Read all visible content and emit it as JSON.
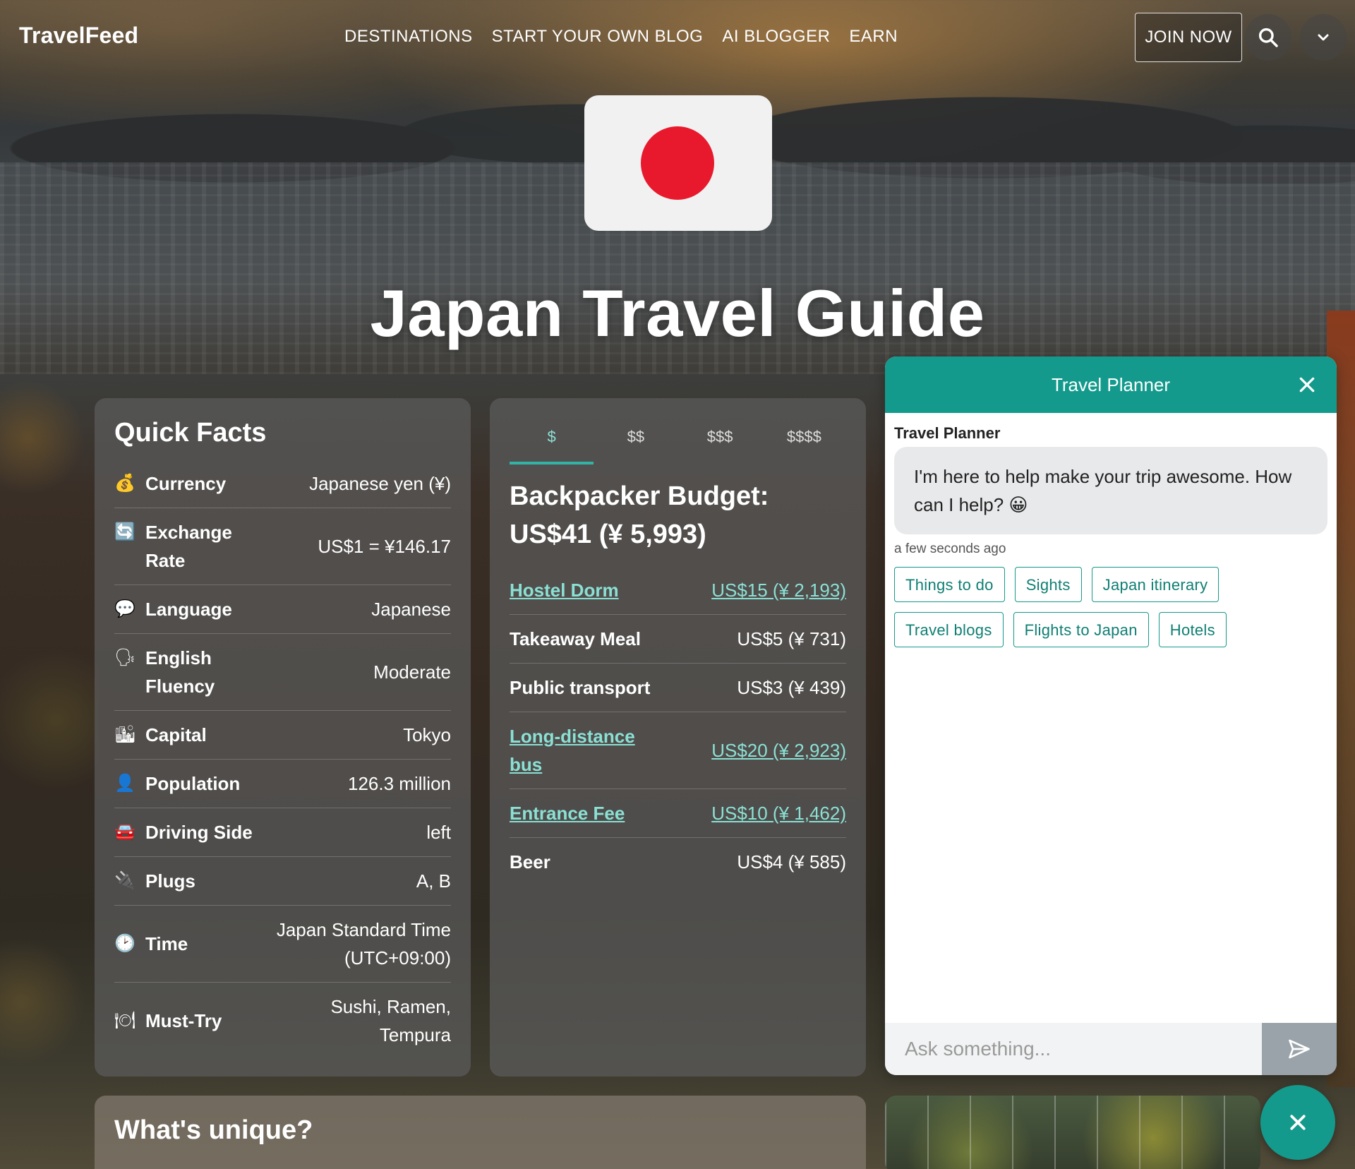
{
  "header": {
    "logo": "TravelFeed",
    "nav": [
      "DESTINATIONS",
      "START YOUR OWN BLOG",
      "AI BLOGGER",
      "EARN"
    ],
    "join_label": "JOIN NOW"
  },
  "hero": {
    "title": "Japan Travel Guide"
  },
  "quick_facts": {
    "title": "Quick Facts",
    "rows": [
      {
        "icon": "money-bag-icon",
        "glyph": "💰",
        "label": "Currency",
        "value": "Japanese yen (¥)"
      },
      {
        "icon": "exchange-icon",
        "glyph": "🔄",
        "label": "Exchange Rate",
        "value": "US$1 = ¥146.17"
      },
      {
        "icon": "speech-bubble-icon",
        "glyph": "💬",
        "label": "Language",
        "value": "Japanese"
      },
      {
        "icon": "speaking-head-icon",
        "glyph": "🗣",
        "label": "English Fluency",
        "value": "Moderate"
      },
      {
        "icon": "cityscape-icon",
        "glyph": "🏙",
        "label": "Capital",
        "value": "Tokyo"
      },
      {
        "icon": "person-icon",
        "glyph": "👤",
        "label": "Population",
        "value": "126.3 million"
      },
      {
        "icon": "car-icon",
        "glyph": "🚘",
        "label": "Driving Side",
        "value": "left"
      },
      {
        "icon": "plug-icon",
        "glyph": "🔌",
        "label": "Plugs",
        "value": "A, B"
      },
      {
        "icon": "clock-icon",
        "glyph": "🕑",
        "label": "Time",
        "value": "Japan Standard Time (UTC+09:00)"
      },
      {
        "icon": "plate-icon",
        "glyph": "🍽",
        "label": "Must-Try",
        "value": "Sushi, Ramen, Tempura"
      }
    ]
  },
  "budget": {
    "tabs": [
      "$",
      "$$",
      "$$$",
      "$$$$"
    ],
    "active_tab": 0,
    "title": "Backpacker Budget: US$41 (¥ 5,993)",
    "rows": [
      {
        "label": "Hostel Dorm",
        "value": "US$15 (¥ 2,193)",
        "link": true
      },
      {
        "label": "Takeaway Meal",
        "value": "US$5 (¥ 731)",
        "link": false
      },
      {
        "label": "Public transport",
        "value": "US$3 (¥ 439)",
        "link": false
      },
      {
        "label": "Long-distance bus",
        "value": "US$20 (¥ 2,923)",
        "link": true
      },
      {
        "label": "Entrance Fee",
        "value": "US$10 (¥ 1,462)",
        "link": true
      },
      {
        "label": "Beer",
        "value": "US$4 (¥ 585)",
        "link": false
      }
    ]
  },
  "unique": {
    "title": "What's unique?"
  },
  "chat": {
    "title": "Travel Planner",
    "sender": "Travel Planner",
    "message": "I'm here to help make your trip awesome. How can I help? 😀",
    "timestamp": "a few seconds ago",
    "chips": [
      "Things to do",
      "Sights",
      "Japan itinerary",
      "Travel blogs",
      "Flights to Japan",
      "Hotels"
    ],
    "input_placeholder": "Ask something..."
  },
  "colors": {
    "accent": "#139a8c",
    "link": "#8be0d4",
    "flag_red": "#e8192c"
  }
}
